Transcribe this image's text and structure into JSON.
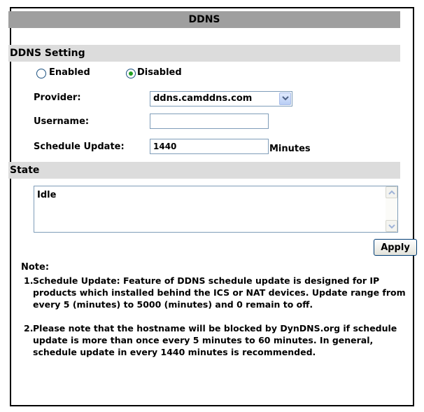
{
  "title": "DDNS",
  "ddns_setting": {
    "section_label": "DDNS Setting",
    "mode": {
      "enabled_label": "Enabled",
      "disabled_label": "Disabled",
      "selected": "Disabled"
    },
    "provider_label": "Provider:",
    "provider_value": "ddns.camddns.com",
    "username_label": "Username:",
    "username_value": "",
    "schedule_label": "Schedule Update:",
    "schedule_value": "1440",
    "schedule_unit": "Minutes"
  },
  "state": {
    "section_label": "State",
    "value": "Idle"
  },
  "apply_label": "Apply",
  "note": {
    "title": "Note:",
    "items": [
      {
        "num": "1.",
        "text": "Schedule Update: Feature of DDNS schedule update is designed for IP products which installed behind the ICS or NAT devices. Update range from every 5 (minutes) to 5000 (minutes) and 0 remain to off."
      },
      {
        "num": "2.",
        "text": "Please note that the hostname will be blocked by DynDNS.org if schedule update is more than once every 5 minutes to 60 minutes. In general, schedule update in every 1440 minutes is recommended."
      }
    ]
  },
  "colors": {
    "title_bar": "#9f9f9f",
    "section_bar": "#dcdcdc",
    "radio_dot": "#21a121"
  }
}
